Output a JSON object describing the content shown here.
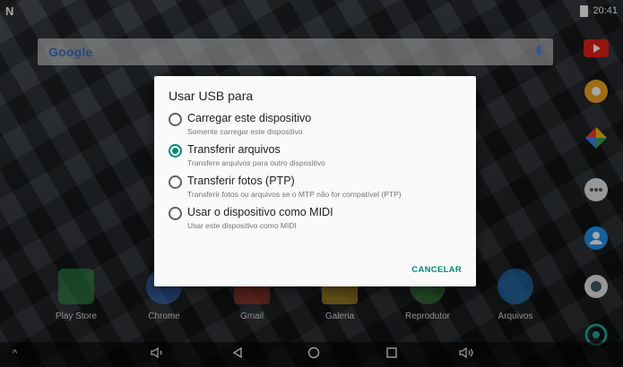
{
  "status_bar": {
    "left_icon": "N",
    "time": "20:41"
  },
  "search": {
    "logo": "Google"
  },
  "home_apps": [
    {
      "label": "Play Store"
    },
    {
      "label": "Chrome"
    },
    {
      "label": "Gmail"
    },
    {
      "label": "Galeria"
    },
    {
      "label": "Reprodutor"
    },
    {
      "label": "Arquivos"
    }
  ],
  "dialog": {
    "title": "Usar USB para",
    "options": [
      {
        "label": "Carregar este dispositivo",
        "desc": "Somente carregar este dispositivo",
        "checked": false
      },
      {
        "label": "Transferir arquivos",
        "desc": "Transfere arquivos para outro dispositivo",
        "checked": true
      },
      {
        "label": "Transferir fotos (PTP)",
        "desc": "Transferir fotos ou arquivos se o MTP não for compatível (PTP)",
        "checked": false
      },
      {
        "label": "Usar o dispositivo como MIDI",
        "desc": "Usar este dispositivo como MIDI",
        "checked": false
      }
    ],
    "cancel": "CANCELAR"
  },
  "colors": {
    "accent": "#00897b"
  }
}
